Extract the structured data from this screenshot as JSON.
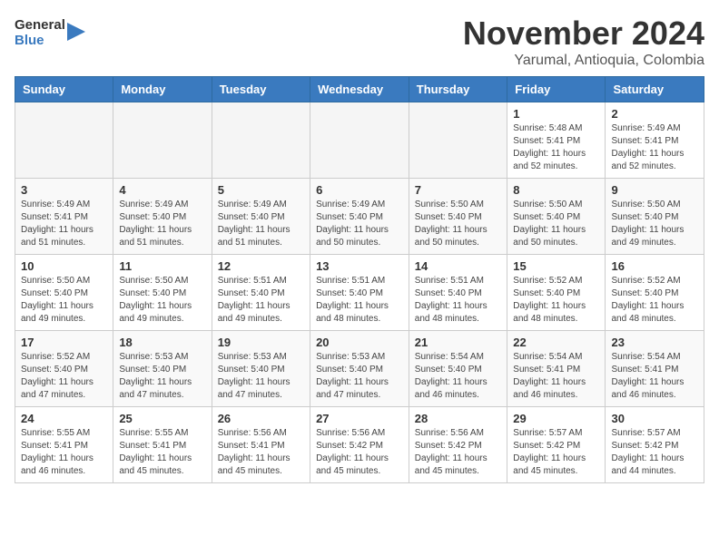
{
  "header": {
    "logo_line1": "General",
    "logo_line2": "Blue",
    "month_title": "November 2024",
    "subtitle": "Yarumal, Antioquia, Colombia"
  },
  "weekdays": [
    "Sunday",
    "Monday",
    "Tuesday",
    "Wednesday",
    "Thursday",
    "Friday",
    "Saturday"
  ],
  "weeks": [
    [
      {
        "day": "",
        "info": ""
      },
      {
        "day": "",
        "info": ""
      },
      {
        "day": "",
        "info": ""
      },
      {
        "day": "",
        "info": ""
      },
      {
        "day": "",
        "info": ""
      },
      {
        "day": "1",
        "info": "Sunrise: 5:48 AM\nSunset: 5:41 PM\nDaylight: 11 hours and 52 minutes."
      },
      {
        "day": "2",
        "info": "Sunrise: 5:49 AM\nSunset: 5:41 PM\nDaylight: 11 hours and 52 minutes."
      }
    ],
    [
      {
        "day": "3",
        "info": "Sunrise: 5:49 AM\nSunset: 5:41 PM\nDaylight: 11 hours and 51 minutes."
      },
      {
        "day": "4",
        "info": "Sunrise: 5:49 AM\nSunset: 5:40 PM\nDaylight: 11 hours and 51 minutes."
      },
      {
        "day": "5",
        "info": "Sunrise: 5:49 AM\nSunset: 5:40 PM\nDaylight: 11 hours and 51 minutes."
      },
      {
        "day": "6",
        "info": "Sunrise: 5:49 AM\nSunset: 5:40 PM\nDaylight: 11 hours and 50 minutes."
      },
      {
        "day": "7",
        "info": "Sunrise: 5:50 AM\nSunset: 5:40 PM\nDaylight: 11 hours and 50 minutes."
      },
      {
        "day": "8",
        "info": "Sunrise: 5:50 AM\nSunset: 5:40 PM\nDaylight: 11 hours and 50 minutes."
      },
      {
        "day": "9",
        "info": "Sunrise: 5:50 AM\nSunset: 5:40 PM\nDaylight: 11 hours and 49 minutes."
      }
    ],
    [
      {
        "day": "10",
        "info": "Sunrise: 5:50 AM\nSunset: 5:40 PM\nDaylight: 11 hours and 49 minutes."
      },
      {
        "day": "11",
        "info": "Sunrise: 5:50 AM\nSunset: 5:40 PM\nDaylight: 11 hours and 49 minutes."
      },
      {
        "day": "12",
        "info": "Sunrise: 5:51 AM\nSunset: 5:40 PM\nDaylight: 11 hours and 49 minutes."
      },
      {
        "day": "13",
        "info": "Sunrise: 5:51 AM\nSunset: 5:40 PM\nDaylight: 11 hours and 48 minutes."
      },
      {
        "day": "14",
        "info": "Sunrise: 5:51 AM\nSunset: 5:40 PM\nDaylight: 11 hours and 48 minutes."
      },
      {
        "day": "15",
        "info": "Sunrise: 5:52 AM\nSunset: 5:40 PM\nDaylight: 11 hours and 48 minutes."
      },
      {
        "day": "16",
        "info": "Sunrise: 5:52 AM\nSunset: 5:40 PM\nDaylight: 11 hours and 48 minutes."
      }
    ],
    [
      {
        "day": "17",
        "info": "Sunrise: 5:52 AM\nSunset: 5:40 PM\nDaylight: 11 hours and 47 minutes."
      },
      {
        "day": "18",
        "info": "Sunrise: 5:53 AM\nSunset: 5:40 PM\nDaylight: 11 hours and 47 minutes."
      },
      {
        "day": "19",
        "info": "Sunrise: 5:53 AM\nSunset: 5:40 PM\nDaylight: 11 hours and 47 minutes."
      },
      {
        "day": "20",
        "info": "Sunrise: 5:53 AM\nSunset: 5:40 PM\nDaylight: 11 hours and 47 minutes."
      },
      {
        "day": "21",
        "info": "Sunrise: 5:54 AM\nSunset: 5:40 PM\nDaylight: 11 hours and 46 minutes."
      },
      {
        "day": "22",
        "info": "Sunrise: 5:54 AM\nSunset: 5:41 PM\nDaylight: 11 hours and 46 minutes."
      },
      {
        "day": "23",
        "info": "Sunrise: 5:54 AM\nSunset: 5:41 PM\nDaylight: 11 hours and 46 minutes."
      }
    ],
    [
      {
        "day": "24",
        "info": "Sunrise: 5:55 AM\nSunset: 5:41 PM\nDaylight: 11 hours and 46 minutes."
      },
      {
        "day": "25",
        "info": "Sunrise: 5:55 AM\nSunset: 5:41 PM\nDaylight: 11 hours and 45 minutes."
      },
      {
        "day": "26",
        "info": "Sunrise: 5:56 AM\nSunset: 5:41 PM\nDaylight: 11 hours and 45 minutes."
      },
      {
        "day": "27",
        "info": "Sunrise: 5:56 AM\nSunset: 5:42 PM\nDaylight: 11 hours and 45 minutes."
      },
      {
        "day": "28",
        "info": "Sunrise: 5:56 AM\nSunset: 5:42 PM\nDaylight: 11 hours and 45 minutes."
      },
      {
        "day": "29",
        "info": "Sunrise: 5:57 AM\nSunset: 5:42 PM\nDaylight: 11 hours and 45 minutes."
      },
      {
        "day": "30",
        "info": "Sunrise: 5:57 AM\nSunset: 5:42 PM\nDaylight: 11 hours and 44 minutes."
      }
    ]
  ]
}
